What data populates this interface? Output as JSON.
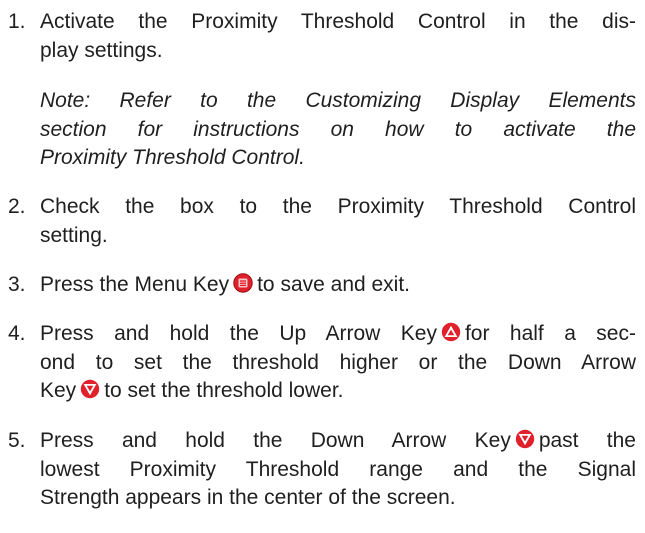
{
  "steps": [
    {
      "number": "1.",
      "lines": [
        "Activate the Proximity Threshold Control in the dis-",
        "play settings."
      ],
      "note": [
        "Note: Refer to the Customizing Display Elements",
        "section for instructions on how to activate the",
        "Proximity Threshold Control."
      ]
    },
    {
      "number": "2.",
      "lines": [
        "Check the box to the Proximity Threshold Control",
        "setting."
      ]
    },
    {
      "number": "3.",
      "before_icon": "Press the Menu Key",
      "after_icon": "to save and exit.",
      "icon": "menu-key-icon"
    },
    {
      "number": "4.",
      "line1_before": "Press and hold the Up Arrow Key",
      "line1_after": "for half a sec-",
      "line2": "ond to set the threshold higher or the Down Arrow",
      "line3_before": "Key",
      "line3_after": "to set the threshold lower.",
      "icons": [
        "up-arrow-key-icon",
        "down-arrow-key-icon"
      ]
    },
    {
      "number": "5.",
      "line1_before": "Press and hold the Down Arrow Key",
      "line1_after": "past the",
      "line2": "lowest Proximity Threshold range and the Signal",
      "line3": "Strength appears in the center of the screen.",
      "icon": "down-arrow-key-icon"
    }
  ],
  "colors": {
    "text": "#1f1f1f",
    "key_red": "#e0202a"
  }
}
